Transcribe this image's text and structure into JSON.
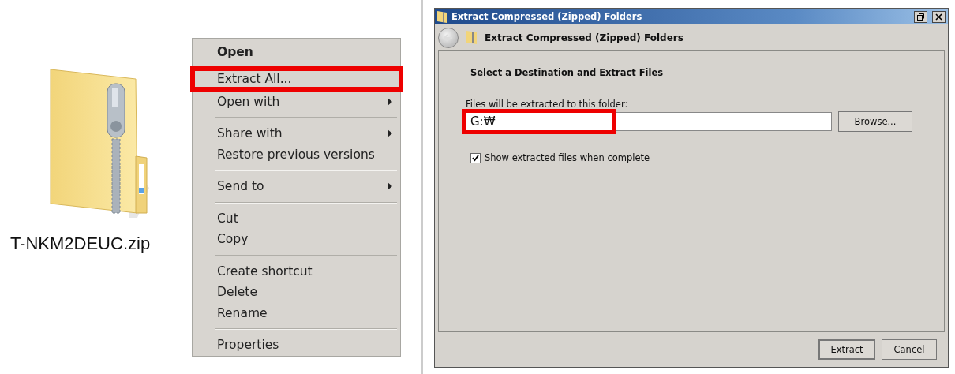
{
  "file": {
    "name": "T-NKM2DEUC.zip"
  },
  "context_menu": {
    "groups": [
      [
        {
          "label": "Open",
          "default": true,
          "submenu": false,
          "highlighted": false
        },
        {
          "label": "Extract All...",
          "default": false,
          "submenu": false,
          "highlighted": true
        },
        {
          "label": "Open with",
          "default": false,
          "submenu": true,
          "highlighted": false
        }
      ],
      [
        {
          "label": "Share with",
          "default": false,
          "submenu": true,
          "highlighted": false
        },
        {
          "label": "Restore previous versions",
          "default": false,
          "submenu": false,
          "highlighted": false
        }
      ],
      [
        {
          "label": "Send to",
          "default": false,
          "submenu": true,
          "highlighted": false
        }
      ],
      [
        {
          "label": "Cut",
          "default": false,
          "submenu": false,
          "highlighted": false
        },
        {
          "label": "Copy",
          "default": false,
          "submenu": false,
          "highlighted": false
        }
      ],
      [
        {
          "label": "Create shortcut",
          "default": false,
          "submenu": false,
          "highlighted": false
        },
        {
          "label": "Delete",
          "default": false,
          "submenu": false,
          "highlighted": false
        },
        {
          "label": "Rename",
          "default": false,
          "submenu": false,
          "highlighted": false
        }
      ],
      [
        {
          "label": "Properties",
          "default": false,
          "submenu": false,
          "highlighted": false
        }
      ]
    ]
  },
  "dialog": {
    "window_title": "Extract Compressed (Zipped) Folders",
    "header_title": "Extract Compressed (Zipped) Folders",
    "heading": "Select a Destination and Extract Files",
    "field_label": "Files will be extracted to this folder:",
    "destination": {
      "value": "G:₩",
      "highlighted": true
    },
    "browse_button": "Browse...",
    "show_files": {
      "label": "Show extracted files when complete",
      "checked": true
    },
    "buttons": [
      {
        "label": "Extract",
        "default": true
      },
      {
        "label": "Cancel",
        "default": false
      }
    ]
  }
}
